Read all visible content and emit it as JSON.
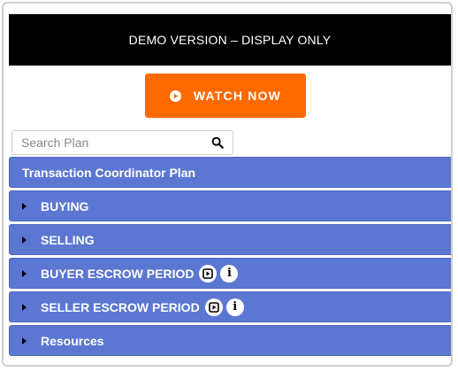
{
  "banner": {
    "text": "DEMO VERSION – DISPLAY ONLY"
  },
  "watch_button": {
    "label": "WATCH NOW"
  },
  "search": {
    "placeholder": "Search Plan"
  },
  "plan": {
    "title": "Transaction Coordinator Plan",
    "sections": [
      {
        "label": "BUYING"
      },
      {
        "label": "SELLING"
      },
      {
        "label": "BUYER ESCROW PERIOD"
      },
      {
        "label": "SELLER ESCROW PERIOD"
      },
      {
        "label": "Resources"
      }
    ]
  },
  "colors": {
    "banner_bg": "#000000",
    "accent_orange": "#ff6a00",
    "row_blue": "#5b77d1"
  },
  "icons": {
    "play": "play-circle-icon",
    "search": "magnifier-icon",
    "expand": "caret-right-icon",
    "video": "video-icon",
    "info": "info-icon"
  }
}
